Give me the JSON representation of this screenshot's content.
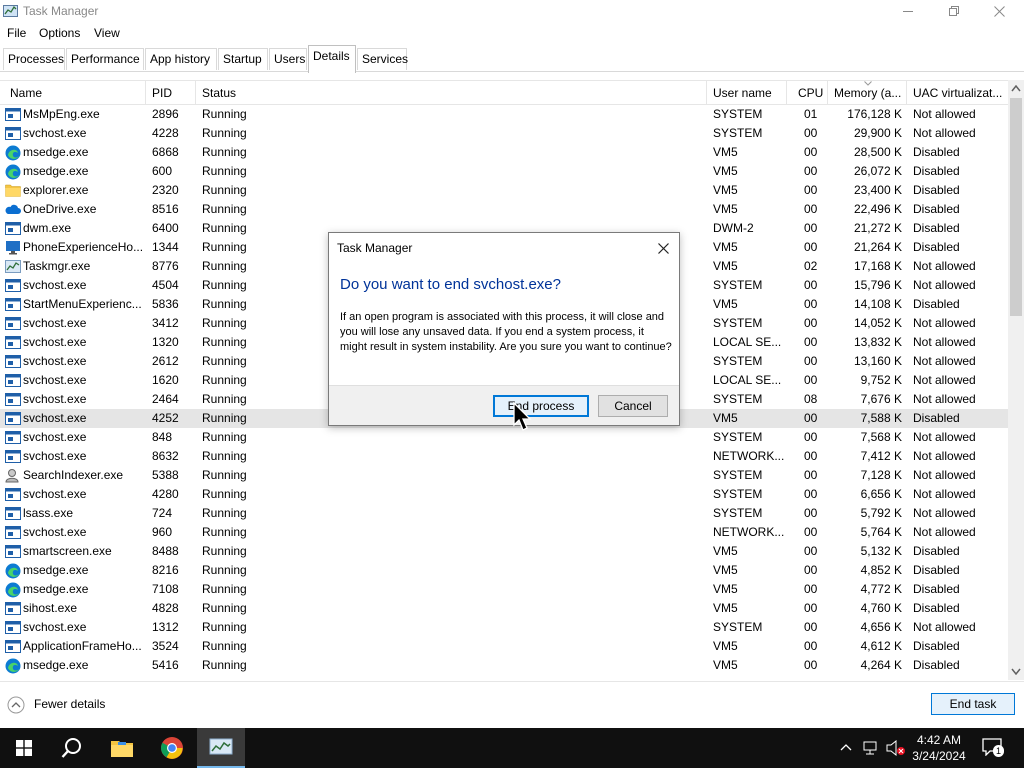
{
  "window": {
    "title": "Task Manager"
  },
  "menu": [
    "File",
    "Options",
    "View"
  ],
  "tabs": [
    "Processes",
    "Performance",
    "App history",
    "Startup",
    "Users",
    "Details",
    "Services"
  ],
  "active_tab": "Details",
  "columns": [
    "Name",
    "PID",
    "Status",
    "User name",
    "CPU",
    "Memory (a...",
    "UAC virtualizat..."
  ],
  "rows": [
    {
      "icon": "generic",
      "name": "MsMpEng.exe",
      "pid": "2896",
      "status": "Running",
      "user": "SYSTEM",
      "cpu": "01",
      "mem": "176,128 K",
      "uac": "Not allowed"
    },
    {
      "icon": "generic",
      "name": "svchost.exe",
      "pid": "4228",
      "status": "Running",
      "user": "SYSTEM",
      "cpu": "00",
      "mem": "29,900 K",
      "uac": "Not allowed"
    },
    {
      "icon": "edge",
      "name": "msedge.exe",
      "pid": "6868",
      "status": "Running",
      "user": "VM5",
      "cpu": "00",
      "mem": "28,500 K",
      "uac": "Disabled"
    },
    {
      "icon": "edge",
      "name": "msedge.exe",
      "pid": "600",
      "status": "Running",
      "user": "VM5",
      "cpu": "00",
      "mem": "26,072 K",
      "uac": "Disabled"
    },
    {
      "icon": "folder",
      "name": "explorer.exe",
      "pid": "2320",
      "status": "Running",
      "user": "VM5",
      "cpu": "00",
      "mem": "23,400 K",
      "uac": "Disabled"
    },
    {
      "icon": "cloud",
      "name": "OneDrive.exe",
      "pid": "8516",
      "status": "Running",
      "user": "VM5",
      "cpu": "00",
      "mem": "22,496 K",
      "uac": "Disabled"
    },
    {
      "icon": "generic",
      "name": "dwm.exe",
      "pid": "6400",
      "status": "Running",
      "user": "DWM-2",
      "cpu": "00",
      "mem": "21,272 K",
      "uac": "Disabled"
    },
    {
      "icon": "monitor",
      "name": "PhoneExperienceHo...",
      "pid": "1344",
      "status": "Running",
      "user": "VM5",
      "cpu": "00",
      "mem": "21,264 K",
      "uac": "Disabled"
    },
    {
      "icon": "taskmgr",
      "name": "Taskmgr.exe",
      "pid": "8776",
      "status": "Running",
      "user": "VM5",
      "cpu": "02",
      "mem": "17,168 K",
      "uac": "Not allowed"
    },
    {
      "icon": "generic",
      "name": "svchost.exe",
      "pid": "4504",
      "status": "Running",
      "user": "SYSTEM",
      "cpu": "00",
      "mem": "15,796 K",
      "uac": "Not allowed"
    },
    {
      "icon": "generic",
      "name": "StartMenuExperienc...",
      "pid": "5836",
      "status": "Running",
      "user": "VM5",
      "cpu": "00",
      "mem": "14,108 K",
      "uac": "Disabled"
    },
    {
      "icon": "generic",
      "name": "svchost.exe",
      "pid": "3412",
      "status": "Running",
      "user": "SYSTEM",
      "cpu": "00",
      "mem": "14,052 K",
      "uac": "Not allowed"
    },
    {
      "icon": "generic",
      "name": "svchost.exe",
      "pid": "1320",
      "status": "Running",
      "user": "LOCAL SE...",
      "cpu": "00",
      "mem": "13,832 K",
      "uac": "Not allowed"
    },
    {
      "icon": "generic",
      "name": "svchost.exe",
      "pid": "2612",
      "status": "Running",
      "user": "SYSTEM",
      "cpu": "00",
      "mem": "13,160 K",
      "uac": "Not allowed"
    },
    {
      "icon": "generic",
      "name": "svchost.exe",
      "pid": "1620",
      "status": "Running",
      "user": "LOCAL SE...",
      "cpu": "00",
      "mem": "9,752 K",
      "uac": "Not allowed"
    },
    {
      "icon": "generic",
      "name": "svchost.exe",
      "pid": "2464",
      "status": "Running",
      "user": "SYSTEM",
      "cpu": "08",
      "mem": "7,676 K",
      "uac": "Not allowed"
    },
    {
      "icon": "generic",
      "name": "svchost.exe",
      "pid": "4252",
      "status": "Running",
      "user": "VM5",
      "cpu": "00",
      "mem": "7,588 K",
      "uac": "Disabled",
      "selected": true
    },
    {
      "icon": "generic",
      "name": "svchost.exe",
      "pid": "848",
      "status": "Running",
      "user": "SYSTEM",
      "cpu": "00",
      "mem": "7,568 K",
      "uac": "Not allowed"
    },
    {
      "icon": "generic",
      "name": "svchost.exe",
      "pid": "8632",
      "status": "Running",
      "user": "NETWORK...",
      "cpu": "00",
      "mem": "7,412 K",
      "uac": "Not allowed"
    },
    {
      "icon": "search",
      "name": "SearchIndexer.exe",
      "pid": "5388",
      "status": "Running",
      "user": "SYSTEM",
      "cpu": "00",
      "mem": "7,128 K",
      "uac": "Not allowed"
    },
    {
      "icon": "generic",
      "name": "svchost.exe",
      "pid": "4280",
      "status": "Running",
      "user": "SYSTEM",
      "cpu": "00",
      "mem": "6,656 K",
      "uac": "Not allowed"
    },
    {
      "icon": "generic",
      "name": "lsass.exe",
      "pid": "724",
      "status": "Running",
      "user": "SYSTEM",
      "cpu": "00",
      "mem": "5,792 K",
      "uac": "Not allowed"
    },
    {
      "icon": "generic",
      "name": "svchost.exe",
      "pid": "960",
      "status": "Running",
      "user": "NETWORK...",
      "cpu": "00",
      "mem": "5,764 K",
      "uac": "Not allowed"
    },
    {
      "icon": "generic",
      "name": "smartscreen.exe",
      "pid": "8488",
      "status": "Running",
      "user": "VM5",
      "cpu": "00",
      "mem": "5,132 K",
      "uac": "Disabled"
    },
    {
      "icon": "edge",
      "name": "msedge.exe",
      "pid": "8216",
      "status": "Running",
      "user": "VM5",
      "cpu": "00",
      "mem": "4,852 K",
      "uac": "Disabled"
    },
    {
      "icon": "edge",
      "name": "msedge.exe",
      "pid": "7108",
      "status": "Running",
      "user": "VM5",
      "cpu": "00",
      "mem": "4,772 K",
      "uac": "Disabled"
    },
    {
      "icon": "generic",
      "name": "sihost.exe",
      "pid": "4828",
      "status": "Running",
      "user": "VM5",
      "cpu": "00",
      "mem": "4,760 K",
      "uac": "Disabled"
    },
    {
      "icon": "generic",
      "name": "svchost.exe",
      "pid": "1312",
      "status": "Running",
      "user": "SYSTEM",
      "cpu": "00",
      "mem": "4,656 K",
      "uac": "Not allowed"
    },
    {
      "icon": "generic",
      "name": "ApplicationFrameHo...",
      "pid": "3524",
      "status": "Running",
      "user": "VM5",
      "cpu": "00",
      "mem": "4,612 K",
      "uac": "Disabled"
    },
    {
      "icon": "edge",
      "name": "msedge.exe",
      "pid": "5416",
      "status": "Running",
      "user": "VM5",
      "cpu": "00",
      "mem": "4,264 K",
      "uac": "Disabled"
    }
  ],
  "footer": {
    "fewer_details": "Fewer details",
    "end_task": "End task"
  },
  "dialog": {
    "title": "Task Manager",
    "heading": "Do you want to end svchost.exe?",
    "body": "If an open program is associated with this process, it will close and you will lose any unsaved data. If you end a system process, it might result in system instability. Are you sure you want to continue?",
    "confirm": "End process",
    "cancel": "Cancel"
  },
  "taskbar": {
    "time": "4:42 AM",
    "date": "3/24/2024",
    "notification_count": "1"
  },
  "colors": {
    "accent": "#0078d7",
    "dialog_heading": "#003399",
    "selected_row": "#e5e5e5",
    "taskbar": "#101010"
  }
}
